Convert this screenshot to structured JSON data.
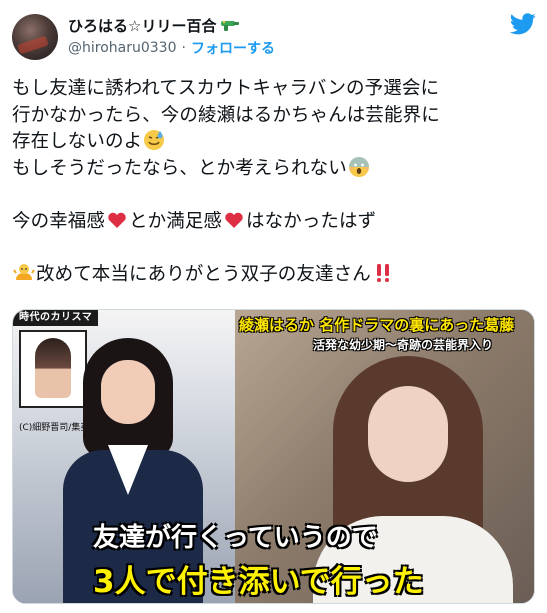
{
  "user": {
    "display_name": "ひろはる☆リリー百合",
    "handle": "@hiroharu0330",
    "separator": "·",
    "follow_label": "フォローする",
    "name_emoji_icon": "water-gun-icon",
    "platform_icon": "twitter-bird-icon"
  },
  "tweet": {
    "lines": [
      "もし友達に誘われてスカウトキャラバンの予選会に",
      "行かなかったら、今の綾瀬はるかちゃんは芸能界に",
      "存在しないのよ",
      "もしそうだったなら、とか考えられない",
      "今の幸福感",
      "とか満足感",
      "はなかったはず",
      "改めて本当にありがとう双子の友達さん"
    ],
    "emojis": {
      "sweat": "sweat-smile-icon",
      "scream": "scream-icon",
      "heart": "red-heart-icon",
      "baby": "baby-chick-icon",
      "bangbang": "double-exclamation-icon"
    }
  },
  "media": {
    "corner_title": "時代のカリスマ",
    "copyright": "(C)細野晋司/集英社",
    "caption_top": "綾瀬はるか 名作ドラマの裏にあった葛藤",
    "caption_sub": "活発な幼少期～奇跡の芸能界入り",
    "subtitle_line1": "友達が行くっていうので",
    "subtitle_line2": "3人で付き添いで行った"
  },
  "colors": {
    "link": "#1d9bf0",
    "twitter": "#1d9bf0",
    "text": "#0f1419",
    "muted": "#536471",
    "heart": "#e0245e"
  }
}
